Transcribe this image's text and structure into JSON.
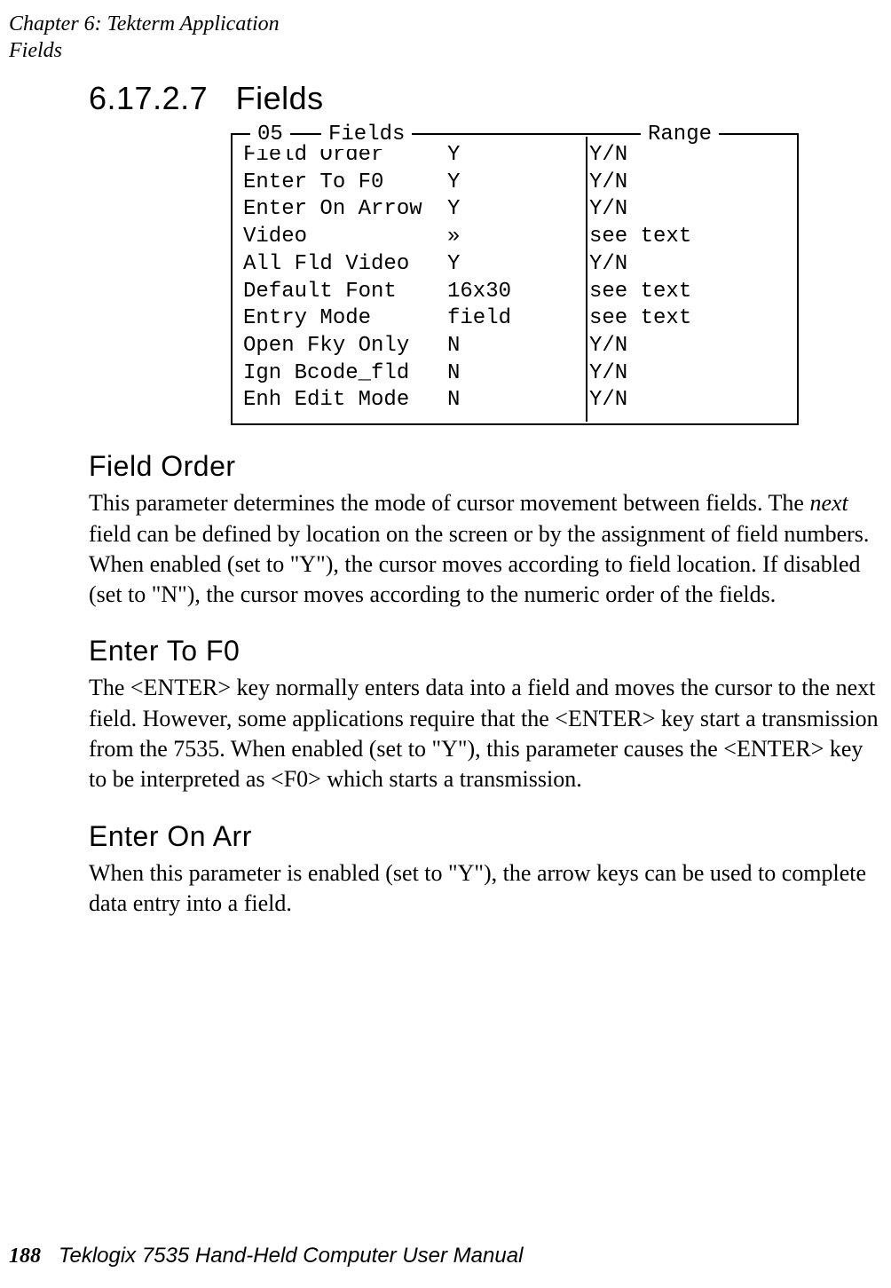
{
  "runningHead": {
    "line1": "Chapter 6: Tekterm Application",
    "line2": "Fields"
  },
  "section": {
    "number": "6.17.2.7",
    "title": "Fields"
  },
  "box": {
    "legendNum": "05",
    "legendTitle": "Fields",
    "legendRange": "Range",
    "rows": [
      {
        "label": "Field Order",
        "value": "Y",
        "range": "Y/N"
      },
      {
        "label": "Enter To F0",
        "value": "Y",
        "range": "Y/N"
      },
      {
        "label": "Enter On Arrow",
        "value": "Y",
        "range": "Y/N"
      },
      {
        "label": "Video",
        "value": "»",
        "range": "see text"
      },
      {
        "label": "All Fld Video",
        "value": "Y",
        "range": "Y/N"
      },
      {
        "label": "Default Font",
        "value": "16x30",
        "range": "see text"
      },
      {
        "label": "Entry Mode",
        "value": "field",
        "range": "see text"
      },
      {
        "label": "Open Fky Only",
        "value": "N",
        "range": "Y/N"
      },
      {
        "label": "Ign Bcode_fld",
        "value": "N",
        "range": "Y/N"
      },
      {
        "label": "Enh Edit Mode",
        "value": "N",
        "range": "Y/N"
      }
    ]
  },
  "subsections": {
    "fieldOrder": {
      "heading": "Field Order",
      "part1": "This parameter determines the mode of cursor movement between fields. The ",
      "emph": "next",
      "part2": " field can be defined by location on the screen or by the assignment of field numbers. When enabled (set to \"Y\"), the cursor moves according to field location. If disabled (set to \"N\"), the cursor moves according to the numeric order of the fields."
    },
    "enterToF0": {
      "heading": "Enter To F0",
      "text": "The <ENTER> key normally enters data into a field and moves the cursor to the next field. However, some applications require that the <ENTER> key start a transmission from the 7535. When enabled (set to \"Y\"), this parameter causes the <ENTER> key to be interpreted as <F0> which starts a transmission."
    },
    "enterOnArr": {
      "heading": "Enter On Arr",
      "text": "When this parameter is enabled (set to \"Y\"), the arrow keys can be used to complete data entry into a field."
    }
  },
  "footer": {
    "pageNum": "188",
    "text": "Teklogix 7535 Hand-Held Computer User Manual"
  }
}
